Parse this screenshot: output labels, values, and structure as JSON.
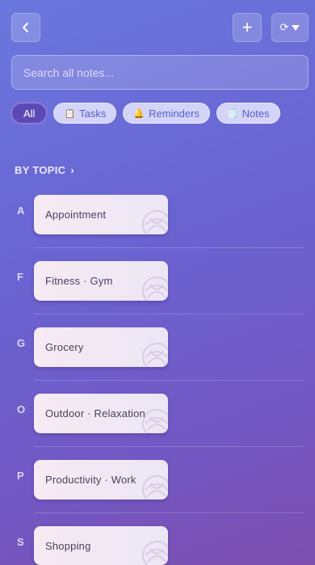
{
  "toolbar": {
    "add_label": "+",
    "sort_label": "⟳"
  },
  "search": {
    "placeholder": "Search all notes..."
  },
  "filters": [
    {
      "label": "All",
      "emoji": ""
    },
    {
      "label": "Tasks",
      "emoji": "📋"
    },
    {
      "label": "Reminders",
      "emoji": "🔔"
    },
    {
      "label": "Notes",
      "emoji": "🗒️"
    }
  ],
  "section": {
    "title": "BY TOPIC",
    "chevron": "›"
  },
  "groups": [
    {
      "letter": "A",
      "topic": "Appointment"
    },
    {
      "letter": "F",
      "topic": "Fitness · Gym"
    },
    {
      "letter": "G",
      "topic": "Grocery"
    },
    {
      "letter": "O",
      "topic": "Outdoor · Relaxation"
    },
    {
      "letter": "P",
      "topic": "Productivity · Work"
    },
    {
      "letter": "S",
      "topic": "Shopping"
    }
  ]
}
